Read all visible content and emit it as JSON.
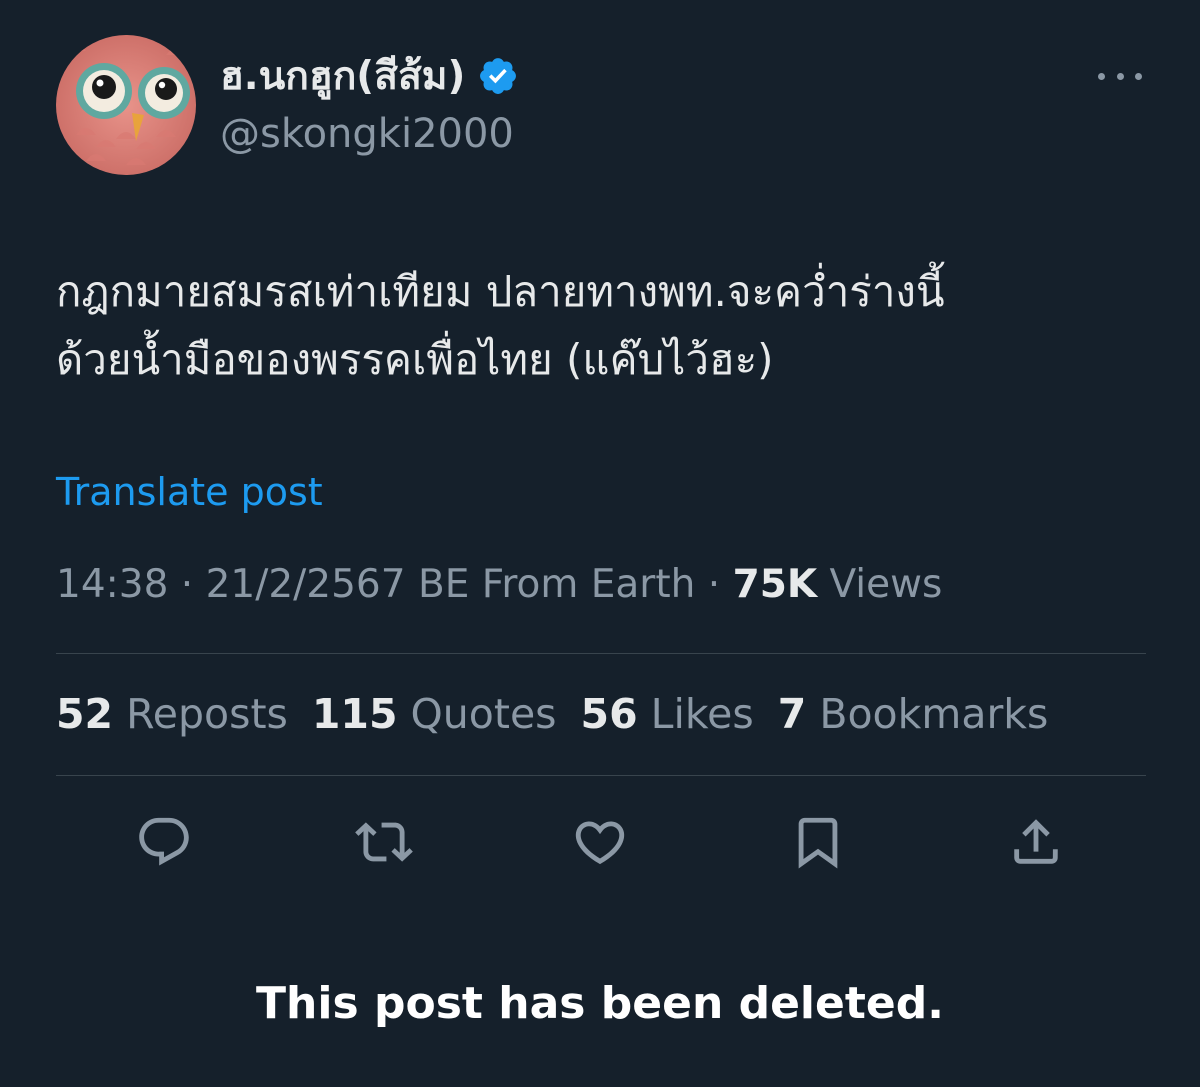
{
  "author": {
    "display_name": "ฮ.นกฮูก(สีส้ม)",
    "handle": "@skongki2000",
    "verified": true,
    "avatar": "owl-avatar"
  },
  "post": {
    "text_lines": [
      "กฎกมายสมรสเท่าเทียม ปลายทางพท.จะคว่ำร่างนี้",
      "ด้วยน้ำมือของพรรคเพื่อไทย (แค๊บไว้ฮะ)"
    ],
    "translate_label": "Translate post",
    "timestamp": "14:38 · 21/2/2567 BE From Earth ·",
    "views_count": "75K",
    "views_label": "Views"
  },
  "stats": [
    {
      "count": "52",
      "label": "Reposts"
    },
    {
      "count": "115",
      "label": "Quotes"
    },
    {
      "count": "56",
      "label": "Likes"
    },
    {
      "count": "7",
      "label": "Bookmarks"
    }
  ],
  "actions": [
    "reply-icon",
    "repost-icon",
    "like-icon",
    "bookmark-icon",
    "share-icon"
  ],
  "deleted_message": "This post has been deleted.",
  "colors": {
    "background": "#15202b",
    "text": "#e7e9ea",
    "secondary": "#8b98a5",
    "link": "#1d9bf0",
    "divider": "#38444d"
  }
}
